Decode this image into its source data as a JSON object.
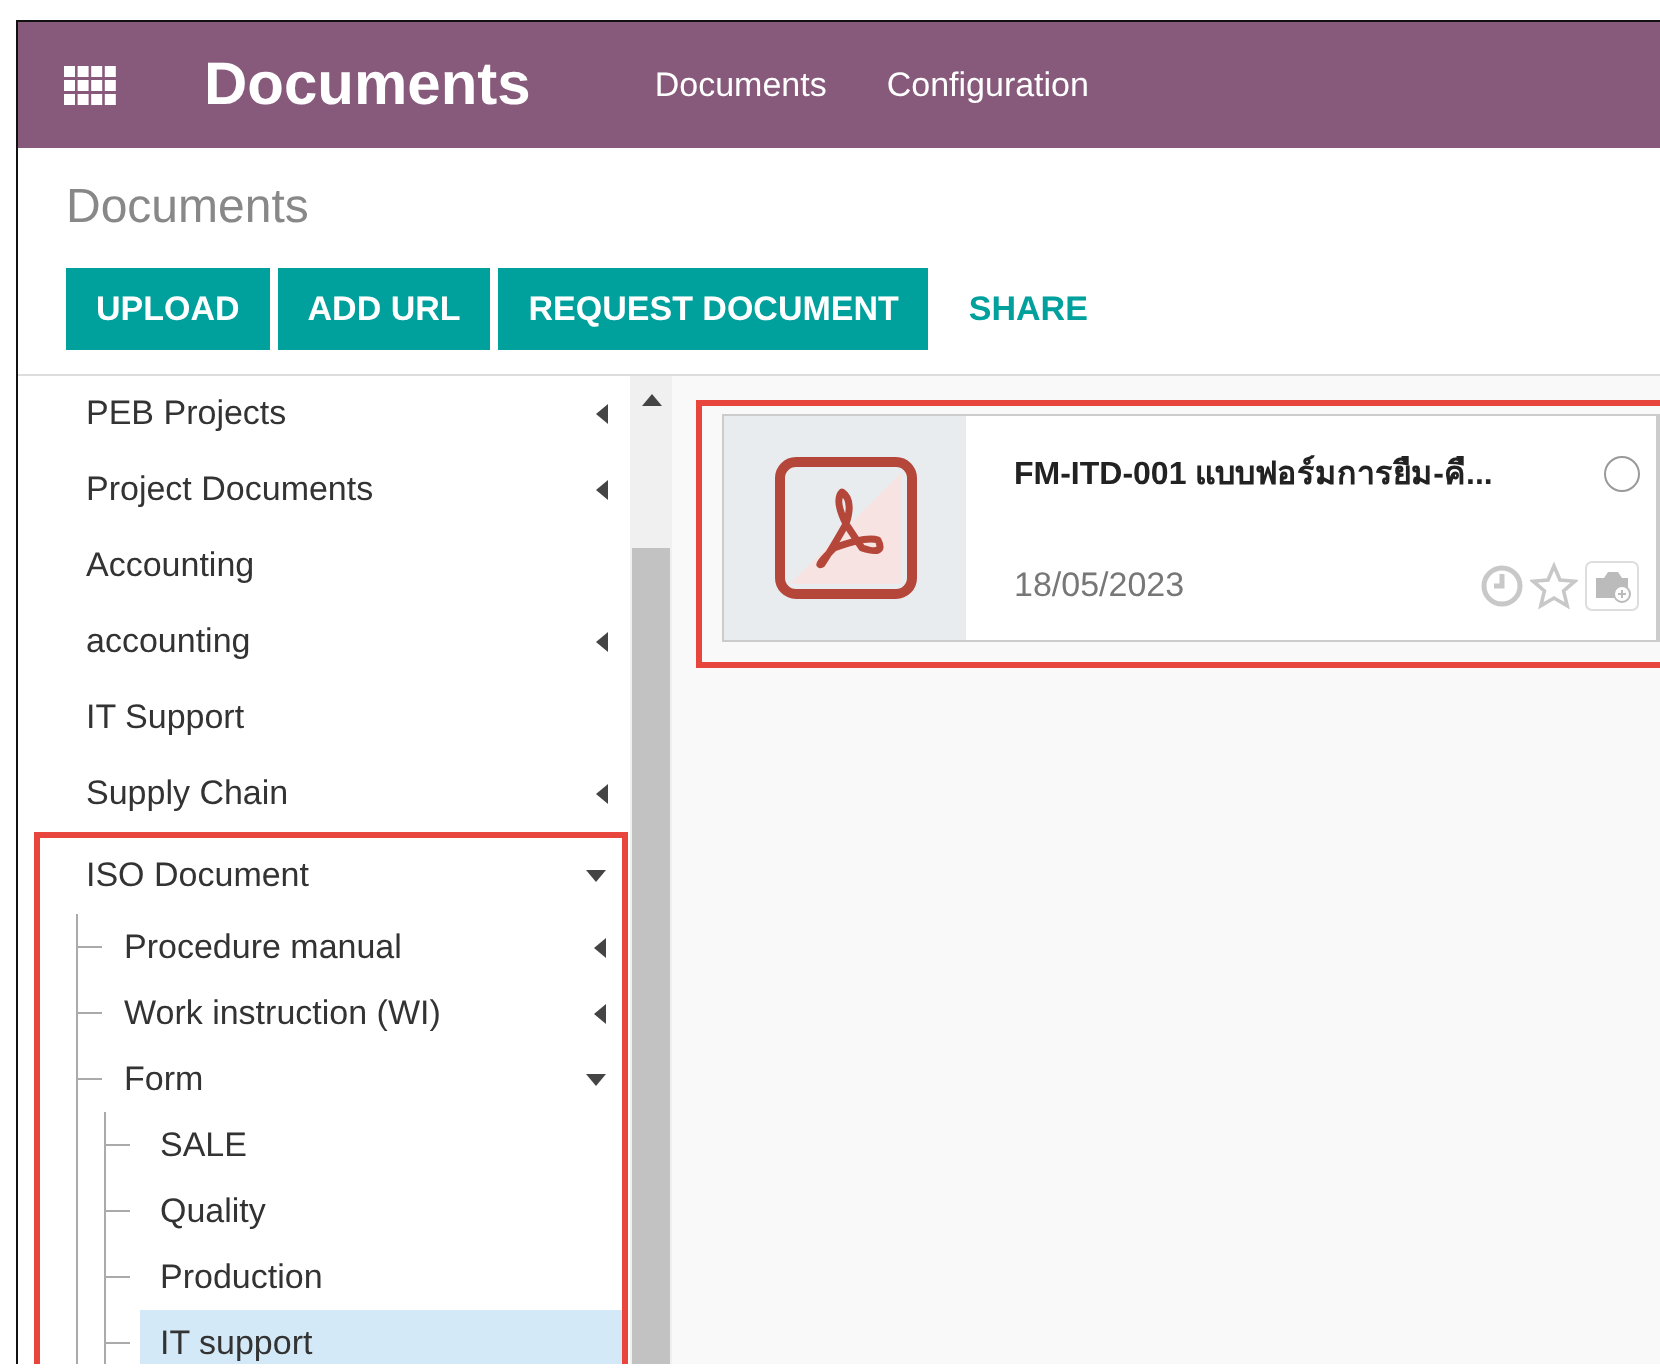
{
  "navbar": {
    "app_title": "Documents",
    "menu": [
      "Documents",
      "Configuration"
    ]
  },
  "control_panel": {
    "breadcrumb": "Documents",
    "buttons": [
      {
        "label": "UPLOAD",
        "kind": "primary"
      },
      {
        "label": "ADD URL",
        "kind": "primary"
      },
      {
        "label": "REQUEST DOCUMENT",
        "kind": "primary"
      },
      {
        "label": "SHARE",
        "kind": "link"
      }
    ]
  },
  "folders": [
    {
      "label": "PEB Projects",
      "expanded": false,
      "selected": false
    },
    {
      "label": "Project Documents",
      "expanded": false,
      "selected": false
    },
    {
      "label": "Accounting",
      "selected": false
    },
    {
      "label": "accounting",
      "expanded": false,
      "selected": false
    },
    {
      "label": "IT Support",
      "selected": false
    },
    {
      "label": "Supply Chain",
      "expanded": false,
      "selected": false
    },
    {
      "label": "ISO Document",
      "expanded": true,
      "selected": false,
      "highlighted": true,
      "children": [
        {
          "label": "Procedure manual",
          "expanded": false,
          "selected": false
        },
        {
          "label": "Work instruction (WI)",
          "expanded": false,
          "selected": false
        },
        {
          "label": "Form",
          "expanded": true,
          "selected": false,
          "children": [
            {
              "label": "SALE",
              "selected": false
            },
            {
              "label": "Quality",
              "selected": false
            },
            {
              "label": "Production",
              "selected": false
            },
            {
              "label": "IT support",
              "selected": true
            }
          ]
        }
      ]
    }
  ],
  "documents": [
    {
      "name": "FM-ITD-001 แบบฟอร์มการยืม-คื...",
      "date": "18/05/2023",
      "kind": "pdf",
      "checked": false,
      "favorite": false,
      "highlighted": true
    }
  ]
}
